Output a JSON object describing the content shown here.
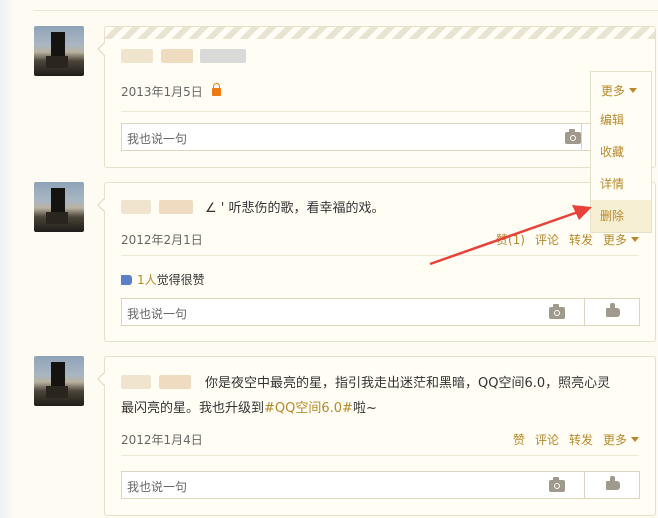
{
  "posts": [
    {
      "text": "",
      "date": "2013年1月5日",
      "comment_placeholder": "我也说一句"
    },
    {
      "text": "∠ ' 听悲伤的歌，看幸福的戏。",
      "date": "2012年2月1日",
      "actions": {
        "like": "赞(1)",
        "comment": "评论",
        "share": "转发",
        "more": "更多"
      },
      "likes_count": "1人",
      "likes_text": "觉得很赞",
      "comment_placeholder": "我也说一句"
    },
    {
      "text_line1": "你是夜空中最亮的星，指引我走出迷茫和黑暗，QQ空间6.0，照亮心灵",
      "text_line2_prefix": "最闪亮的星。我也升级到",
      "hashtag": "#QQ空间6.0#",
      "text_line2_suffix": "啦~",
      "date": "2012年1月4日",
      "actions": {
        "like": "赞",
        "comment": "评论",
        "share": "转发",
        "more": "更多"
      },
      "comment_placeholder": "我也说一句"
    }
  ],
  "dropdown": {
    "header": "更多",
    "items": [
      "编辑",
      "收藏",
      "详情",
      "删除"
    ],
    "highlighted": "删除"
  },
  "colors": {
    "accent": "#b8892b",
    "annotation_arrow": "#e8413a",
    "lock": "#f07b0c",
    "like_icon": "#5b7fc9"
  },
  "icons": [
    "lock-icon",
    "camera-icon",
    "thumbs-up-icon",
    "chevron-down-icon",
    "like-icon"
  ]
}
